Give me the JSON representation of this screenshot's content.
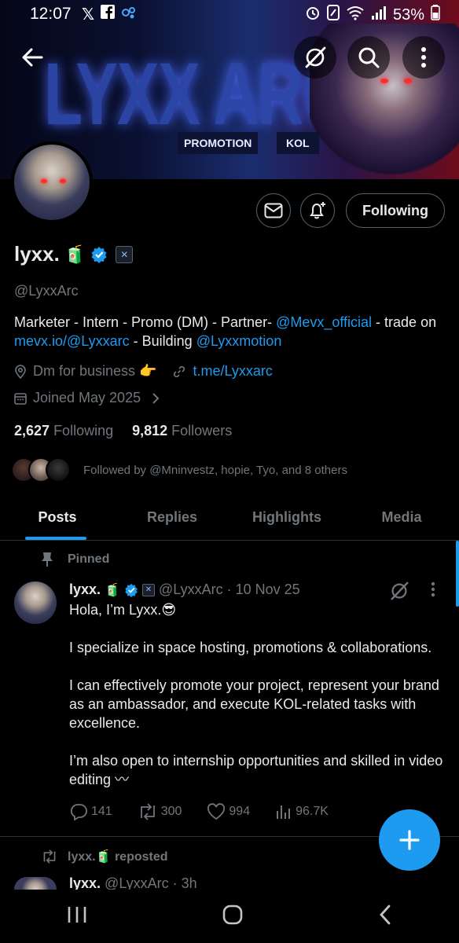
{
  "status_bar": {
    "time": "12:07",
    "battery": "53%",
    "left_icons": [
      "x-logo-icon",
      "facebook-icon",
      "sync-icon"
    ],
    "right_icons": [
      "alarm-icon",
      "nfc-icon",
      "wifi-icon",
      "signal-icon",
      "battery-icon"
    ]
  },
  "banner": {
    "title_text": "LYXX ARC",
    "tag_promotion": "PROMOTION",
    "tag_kol": "KOL"
  },
  "profile": {
    "name": "lyxx.",
    "handle": "@LyxxArc",
    "follow_button": "Following",
    "bio": {
      "part1": "Marketer - Intern - Promo (DM) - Partner- ",
      "mention1": "@Mevx_official",
      "part2": " - trade on ",
      "link1": "mevx.io/@Lyxxarc",
      "part3": " - Building ",
      "mention2": "@Lyxxmotion"
    },
    "location": "Dm for business 👉",
    "website": "t.me/Lyxxarc",
    "joined": "Joined May 2025",
    "following_count": "2,627",
    "following_label": "Following",
    "followers_count": "9,812",
    "followers_label": "Followers",
    "followed_by": "Followed by @Mninvestz, hopie, Tyo, and 8 others"
  },
  "tabs": [
    {
      "label": "Posts",
      "active": true
    },
    {
      "label": "Replies",
      "active": false
    },
    {
      "label": "Highlights",
      "active": false
    },
    {
      "label": "Media",
      "active": false
    }
  ],
  "pinned_post": {
    "pinned_label": "Pinned",
    "author": "lyxx.",
    "handle_date": "@LyxxArc · 10 Nov 25",
    "body": "Hola, I’m Lyxx.😎\n\nI specialize in space hosting, promotions & collaborations.\n\nI can effectively promote your project, represent your brand as an ambassador, and execute KOL-related tasks with excellence.\n\nI’m also open to internship opportunities and skilled in video editing 〰",
    "replies": "141",
    "reposts": "300",
    "likes": "994",
    "views": "96.7K"
  },
  "second_post": {
    "repost_label": "lyxx.🧃 reposted",
    "author": "lyxx.",
    "handle_date": "@LyxxArc · 3h"
  },
  "colors": {
    "accent": "#1d9bf0",
    "muted": "#71767b",
    "text": "#e7e9ea",
    "background": "#000000"
  }
}
